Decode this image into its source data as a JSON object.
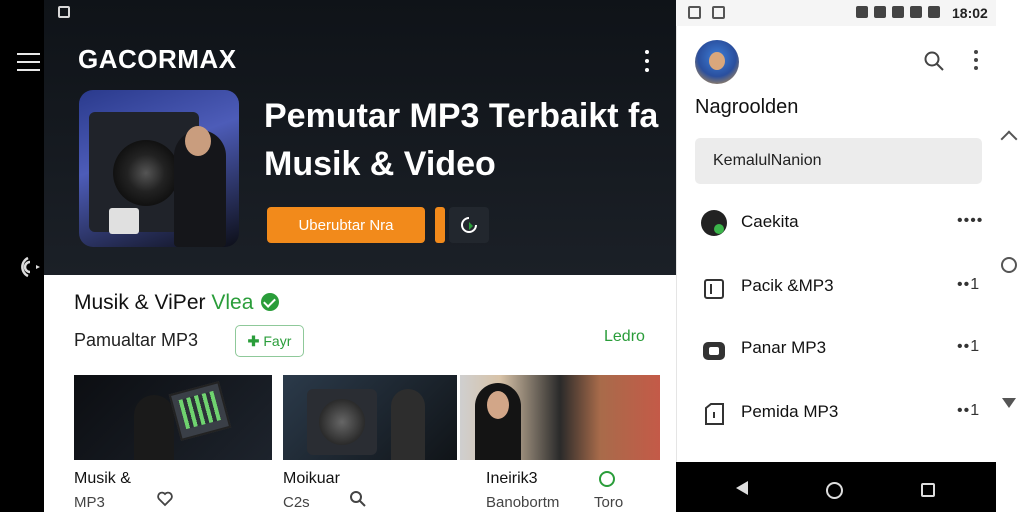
{
  "app": {
    "brand": "GACORMAX",
    "hero_title": "Pemutar MP3 Terbaikt fa Musik & Video",
    "cta_label": "Uberubtar Nra",
    "section_title_main": "Musik & ViPer",
    "section_title_accent": "Vlea",
    "sub_title": "Pamualtar MP3",
    "chip_label": "Fayr",
    "lead_link": "Ledro",
    "cards": [
      {
        "line1": "Musik &",
        "line2": "MP3"
      },
      {
        "line1": "Moikuar",
        "line2": "C2s"
      },
      {
        "line1": "Ineirik3",
        "line2": "Banobortm"
      },
      {
        "line1": "",
        "line2": "Toro"
      }
    ]
  },
  "drawer": {
    "status_time": "18:02",
    "name": "Nagroolden",
    "search_text": "KemalulNanion",
    "items": [
      {
        "label": "Caekita",
        "more": "••••"
      },
      {
        "label": "Pacik &MP3",
        "more": "••1"
      },
      {
        "label": "Panar MP3",
        "more": "••1"
      },
      {
        "label": "Pemida MP3",
        "more": "••1"
      }
    ]
  },
  "colors": {
    "accent_orange": "#f28a1b",
    "accent_green": "#2a9d3a",
    "hero_bg": "#151a20"
  },
  "icons": [
    "menu-icon",
    "wifi-icon",
    "kebab-menu-icon",
    "refresh-icon",
    "verified-icon",
    "search-icon",
    "back-icon",
    "home-icon",
    "recents-icon"
  ]
}
